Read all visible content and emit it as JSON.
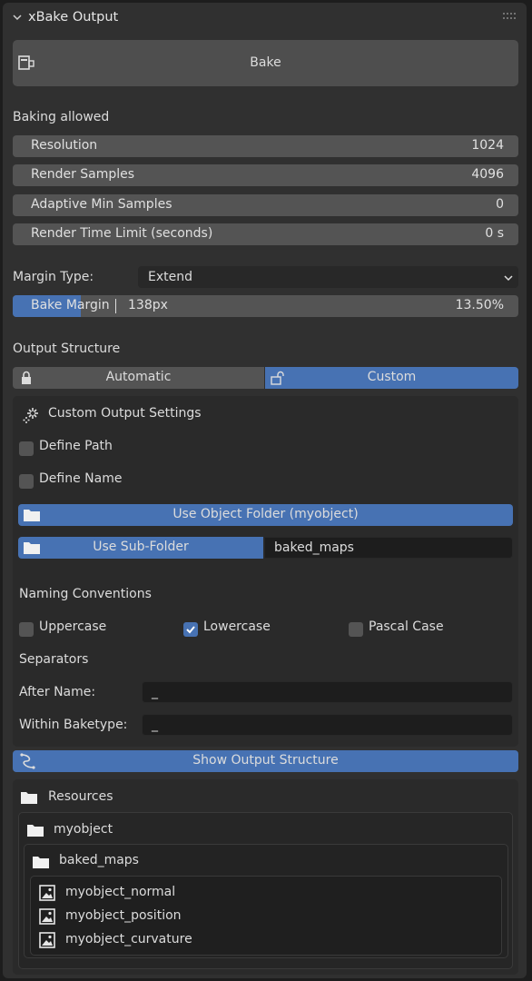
{
  "panel": {
    "title": "xBake Output"
  },
  "bake": {
    "button_label": "Bake"
  },
  "status": {
    "text": "Baking allowed"
  },
  "settings": [
    {
      "label": "Resolution",
      "value": "1024"
    },
    {
      "label": "Render Samples",
      "value": "4096"
    },
    {
      "label": "Adaptive Min Samples",
      "value": "0"
    },
    {
      "label": "Render Time Limit (seconds)",
      "value": "0 s"
    }
  ],
  "margin": {
    "type_label": "Margin Type:",
    "type_value": "Extend",
    "slider_label": "Bake Margin",
    "slider_value": "138px",
    "slider_percent": "13.50%",
    "slider_fill": 0.135
  },
  "output_structure": {
    "heading": "Output Structure",
    "tab_automatic": "Automatic",
    "tab_custom": "Custom",
    "active_tab": "Custom"
  },
  "custom": {
    "heading": "Custom Output Settings",
    "define_path": {
      "label": "Define Path",
      "checked": false
    },
    "define_name": {
      "label": "Define Name",
      "checked": false
    },
    "use_object_folder": "Use Object Folder (myobject)",
    "use_sub_folder": "Use Sub-Folder",
    "sub_folder_value": "baked_maps"
  },
  "naming": {
    "heading": "Naming Conventions",
    "options": [
      {
        "label": "Uppercase",
        "checked": false
      },
      {
        "label": "Lowercase",
        "checked": true
      },
      {
        "label": "Pascal Case",
        "checked": false
      }
    ]
  },
  "separators": {
    "heading": "Separators",
    "after_name_label": "After Name:",
    "after_name_value": "_",
    "within_baketype_label": "Within Baketype:",
    "within_baketype_value": "_"
  },
  "show_structure": {
    "label": "Show Output Structure"
  },
  "tree": {
    "root": "Resources",
    "object": "myobject",
    "folder": "baked_maps",
    "files": [
      "myobject_normal",
      "myobject_position",
      "myobject_curvature"
    ]
  },
  "colors": {
    "accent": "#4772b3",
    "panel": "#303030",
    "field": "#545454"
  }
}
